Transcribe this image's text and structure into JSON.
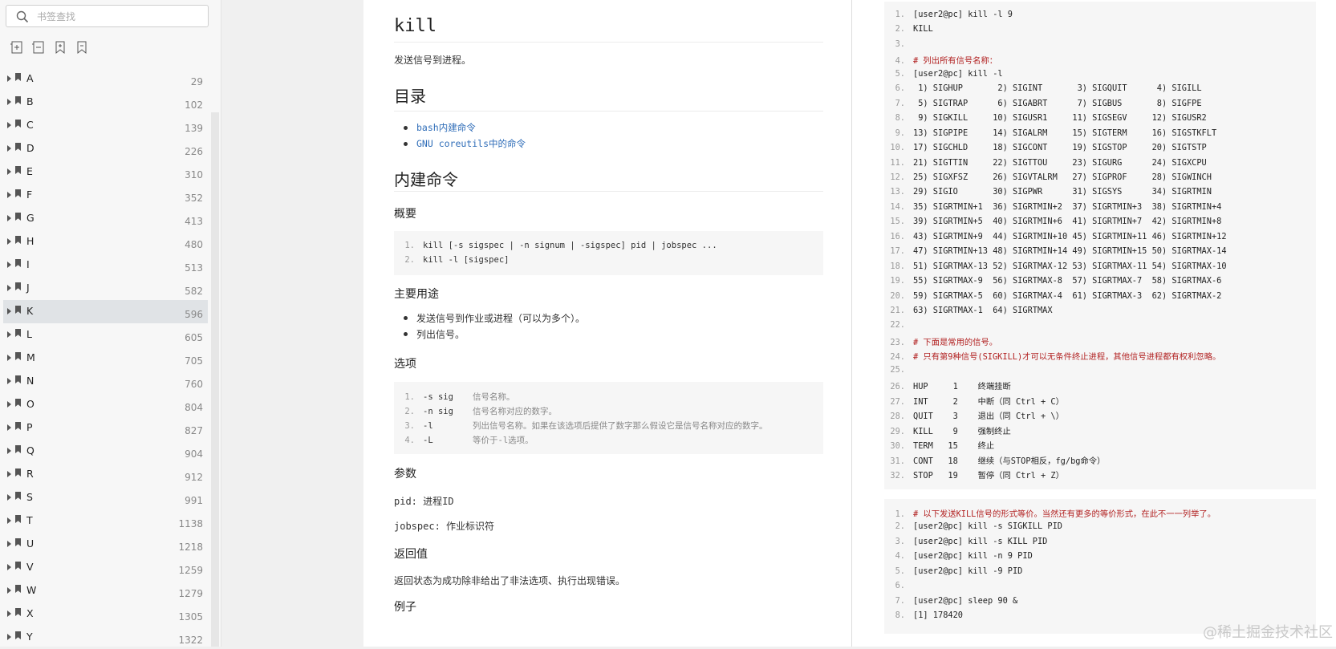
{
  "search": {
    "placeholder": "书签查找"
  },
  "toolbar": {
    "icons": [
      "expand-all-icon",
      "collapse-all-icon",
      "add-bookmark-icon",
      "bookmark-icon"
    ]
  },
  "bookmarks": [
    {
      "letter": "A",
      "page": "29"
    },
    {
      "letter": "B",
      "page": "102"
    },
    {
      "letter": "C",
      "page": "139"
    },
    {
      "letter": "D",
      "page": "226"
    },
    {
      "letter": "E",
      "page": "310"
    },
    {
      "letter": "F",
      "page": "352"
    },
    {
      "letter": "G",
      "page": "413"
    },
    {
      "letter": "H",
      "page": "480"
    },
    {
      "letter": "I",
      "page": "513"
    },
    {
      "letter": "J",
      "page": "582"
    },
    {
      "letter": "K",
      "page": "596"
    },
    {
      "letter": "L",
      "page": "605"
    },
    {
      "letter": "M",
      "page": "705"
    },
    {
      "letter": "N",
      "page": "760"
    },
    {
      "letter": "O",
      "page": "804"
    },
    {
      "letter": "P",
      "page": "827"
    },
    {
      "letter": "Q",
      "page": "904"
    },
    {
      "letter": "R",
      "page": "912"
    },
    {
      "letter": "S",
      "page": "991"
    },
    {
      "letter": "T",
      "page": "1138"
    },
    {
      "letter": "U",
      "page": "1218"
    },
    {
      "letter": "V",
      "page": "1259"
    },
    {
      "letter": "W",
      "page": "1279"
    },
    {
      "letter": "X",
      "page": "1305"
    },
    {
      "letter": "Y",
      "page": "1322"
    }
  ],
  "selected_bookmark": "K",
  "doc": {
    "title": "kill",
    "desc": "发送信号到进程。",
    "toc_heading": "目录",
    "toc": [
      "bash内建命令",
      "GNU coreutils中的命令"
    ],
    "builtin_heading": "内建命令",
    "synopsis_heading": "概要",
    "synopsis_lines": [
      "kill [-s sigspec | -n signum | -sigspec] pid | jobspec ...",
      "kill -l [sigspec]"
    ],
    "usage_heading": "主要用途",
    "usage": [
      "发送信号到作业或进程（可以为多个）。",
      "列出信号。"
    ],
    "options_heading": "选项",
    "options": [
      {
        "opt": "-s sig",
        "desc": "信号名称。"
      },
      {
        "opt": "-n sig",
        "desc": "信号名称对应的数字。"
      },
      {
        "opt": "-l",
        "desc": "列出信号名称。如果在该选项后提供了数字那么假设它是信号名称对应的数字。"
      },
      {
        "opt": "-L",
        "desc": "等价于-l选项。"
      }
    ],
    "params_heading": "参数",
    "param_pid": "pid: 进程ID",
    "param_jobspec": "jobspec: 作业标识符",
    "return_heading": "返回值",
    "return_text": "返回状态为成功除非给出了非法选项、执行出现错误。",
    "examples_heading": "例子"
  },
  "code_block_1": [
    "[user2@pc] kill -l 9",
    "KILL",
    "",
    "# 列出所有信号名称：",
    "[user2@pc] kill -l",
    " 1) SIGHUP       2) SIGINT       3) SIGQUIT      4) SIGILL",
    " 5) SIGTRAP      6) SIGABRT      7) SIGBUS       8) SIGFPE",
    " 9) SIGKILL     10) SIGUSR1     11) SIGSEGV     12) SIGUSR2",
    "13) SIGPIPE     14) SIGALRM     15) SIGTERM     16) SIGSTKFLT",
    "17) SIGCHLD     18) SIGCONT     19) SIGSTOP     20) SIGTSTP",
    "21) SIGTTIN     22) SIGTTOU     23) SIGURG      24) SIGXCPU",
    "25) SIGXFSZ     26) SIGVTALRM   27) SIGPROF     28) SIGWINCH",
    "29) SIGIO       30) SIGPWR      31) SIGSYS      34) SIGRTMIN",
    "35) SIGRTMIN+1  36) SIGRTMIN+2  37) SIGRTMIN+3  38) SIGRTMIN+4",
    "39) SIGRTMIN+5  40) SIGRTMIN+6  41) SIGRTMIN+7  42) SIGRTMIN+8",
    "43) SIGRTMIN+9  44) SIGRTMIN+10 45) SIGRTMIN+11 46) SIGRTMIN+12",
    "47) SIGRTMIN+13 48) SIGRTMIN+14 49) SIGRTMIN+15 50) SIGRTMAX-14",
    "51) SIGRTMAX-13 52) SIGRTMAX-12 53) SIGRTMAX-11 54) SIGRTMAX-10",
    "55) SIGRTMAX-9  56) SIGRTMAX-8  57) SIGRTMAX-7  58) SIGRTMAX-6",
    "59) SIGRTMAX-5  60) SIGRTMAX-4  61) SIGRTMAX-3  62) SIGRTMAX-2",
    "63) SIGRTMAX-1  64) SIGRTMAX",
    "",
    "# 下面是常用的信号。",
    "# 只有第9种信号(SIGKILL)才可以无条件终止进程，其他信号进程都有权利忽略。",
    "",
    "HUP     1    终端挂断",
    "INT     2    中断（同 Ctrl + C）",
    "QUIT    3    退出（同 Ctrl + \\）",
    "KILL    9    强制终止",
    "TERM   15    终止",
    "CONT   18    继续（与STOP相反，fg/bg命令）",
    "STOP   19    暂停（同 Ctrl + Z）"
  ],
  "code_block_2": [
    "# 以下发送KILL信号的形式等价。当然还有更多的等价形式，在此不一一列举了。",
    "[user2@pc] kill -s SIGKILL PID",
    "[user2@pc] kill -s KILL PID",
    "[user2@pc] kill -n 9 PID",
    "[user2@pc] kill -9 PID",
    "",
    "[user2@pc] sleep 90 &",
    "[1] 178420"
  ],
  "watermark": "@稀土掘金技术社区",
  "colors": {
    "link": "#2f6db8",
    "comment": "#b22222",
    "code_bg": "#f6f6f6",
    "selected": "#e0e3e6"
  }
}
